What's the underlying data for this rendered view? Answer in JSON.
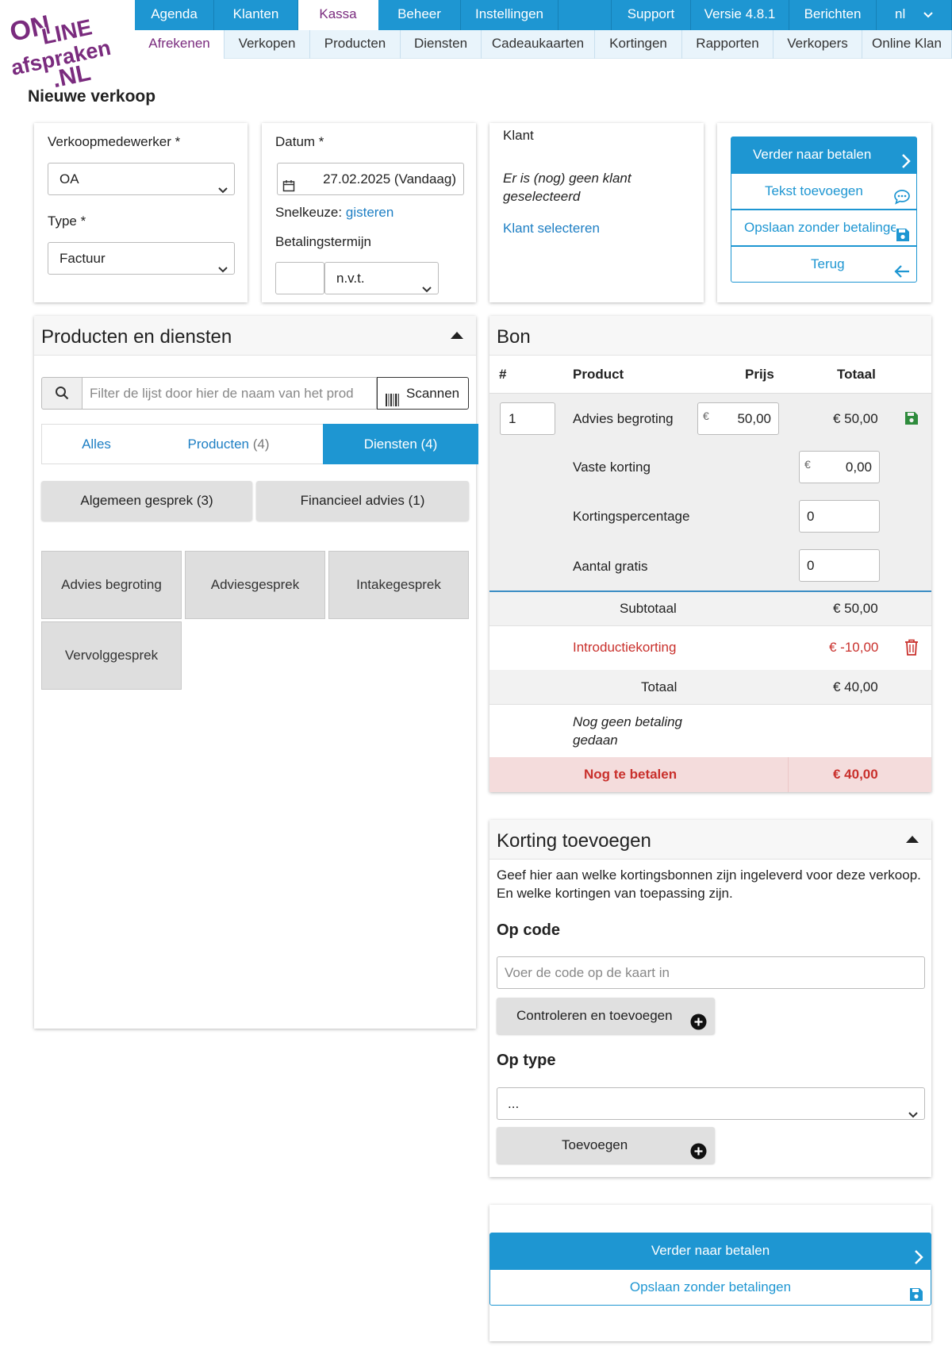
{
  "nav": {
    "main": [
      {
        "label": "Agenda"
      },
      {
        "label": "Klanten"
      },
      {
        "label": "Kassa"
      },
      {
        "label": "Beheer"
      },
      {
        "label": "Instellingen"
      },
      {
        "label": ""
      },
      {
        "label": "Support"
      },
      {
        "label": "Versie 4.8.1"
      },
      {
        "label": "Berichten"
      },
      {
        "label": "nl"
      }
    ],
    "sub": [
      {
        "label": "Afrekenen"
      },
      {
        "label": "Verkopen"
      },
      {
        "label": "Producten"
      },
      {
        "label": "Diensten"
      },
      {
        "label": "Cadeaukaarten"
      },
      {
        "label": "Kortingen"
      },
      {
        "label": "Rapporten"
      },
      {
        "label": "Verkopers"
      },
      {
        "label": "Online Klan"
      }
    ]
  },
  "logo": {
    "line1": "ON",
    "line2": "LINE",
    "line3": "afspraken",
    "line4": ".NL"
  },
  "page_title": "Nieuwe verkoop",
  "sale": {
    "employee_label": "Verkoopmedewerker *",
    "employee_value": "OA",
    "type_label": "Type *",
    "type_value": "Factuur",
    "date_label": "Datum *",
    "date_value": "27.02.2025 (Vandaag)",
    "quick_label": "Snelkeuze:",
    "quick_link": "gisteren",
    "term_label": "Betalingstermijn",
    "term_value": "",
    "term_unit": "n.v.t."
  },
  "customer": {
    "title": "Klant",
    "empty": "Er is (nog) geen klant geselecteerd",
    "select_link": "Klant selecteren"
  },
  "actions": {
    "pay": "Verder naar betalen",
    "add_text": "Tekst toevoegen",
    "save_no_pay": "Opslaan zonder betalingen",
    "back": "Terug"
  },
  "products": {
    "title": "Producten en diensten",
    "filter_placeholder": "Filter de lijst door hier de naam van het prod",
    "scan": "Scannen",
    "tabs": [
      {
        "label": "Alles",
        "count": ""
      },
      {
        "label": "Producten",
        "count": "(4)"
      },
      {
        "label": "Diensten (4)",
        "count": ""
      }
    ],
    "groups": [
      {
        "label": "Algemeen gesprek (3)"
      },
      {
        "label": "Financieel advies (1)"
      }
    ],
    "items": [
      {
        "label": "Advies begroting"
      },
      {
        "label": "Adviesgesprek"
      },
      {
        "label": "Intakegesprek"
      },
      {
        "label": "Vervolggesprek"
      }
    ]
  },
  "receipt": {
    "title": "Bon",
    "col_num": "#",
    "col_product": "Product",
    "col_price": "Prijs",
    "col_total": "Totaal",
    "line": {
      "qty": "1",
      "product": "Advies begroting",
      "currency": "€",
      "price": "50,00",
      "total": "€ 50,00"
    },
    "fixed_discount_label": "Vaste korting",
    "fixed_discount_currency": "€",
    "fixed_discount_value": "0,00",
    "pct_label": "Kortingspercentage",
    "pct_value": "0",
    "free_label": "Aantal gratis",
    "free_value": "0",
    "subtotal_label": "Subtotaal",
    "subtotal_value": "€ 50,00",
    "intro_label": "Introductiekorting",
    "intro_value": "€ -10,00",
    "total_label": "Totaal",
    "total_value": "€ 40,00",
    "no_payment": "Nog geen betaling gedaan",
    "due_label": "Nog te betalen",
    "due_value": "€ 40,00"
  },
  "discount": {
    "title": "Korting toevoegen",
    "desc": "Geef hier aan welke kortingsbonnen zijn ingeleverd voor deze verkoop. En welke kortingen van toepassing zijn.",
    "by_code": "Op code",
    "code_placeholder": "Voer de code op de kaart in",
    "check_add": "Controleren en toevoegen",
    "by_type": "Op type",
    "type_value": "...",
    "add": "Toevoegen"
  },
  "bottom": {
    "pay": "Verder naar betalen",
    "save_no_pay": "Opslaan zonder betalingen"
  },
  "colors": {
    "primary": "#1e96d2",
    "active_purple": "#7a2b7e",
    "danger": "#c9302c",
    "success": "#2e8b3c",
    "due_bg": "#f4dcdc"
  }
}
